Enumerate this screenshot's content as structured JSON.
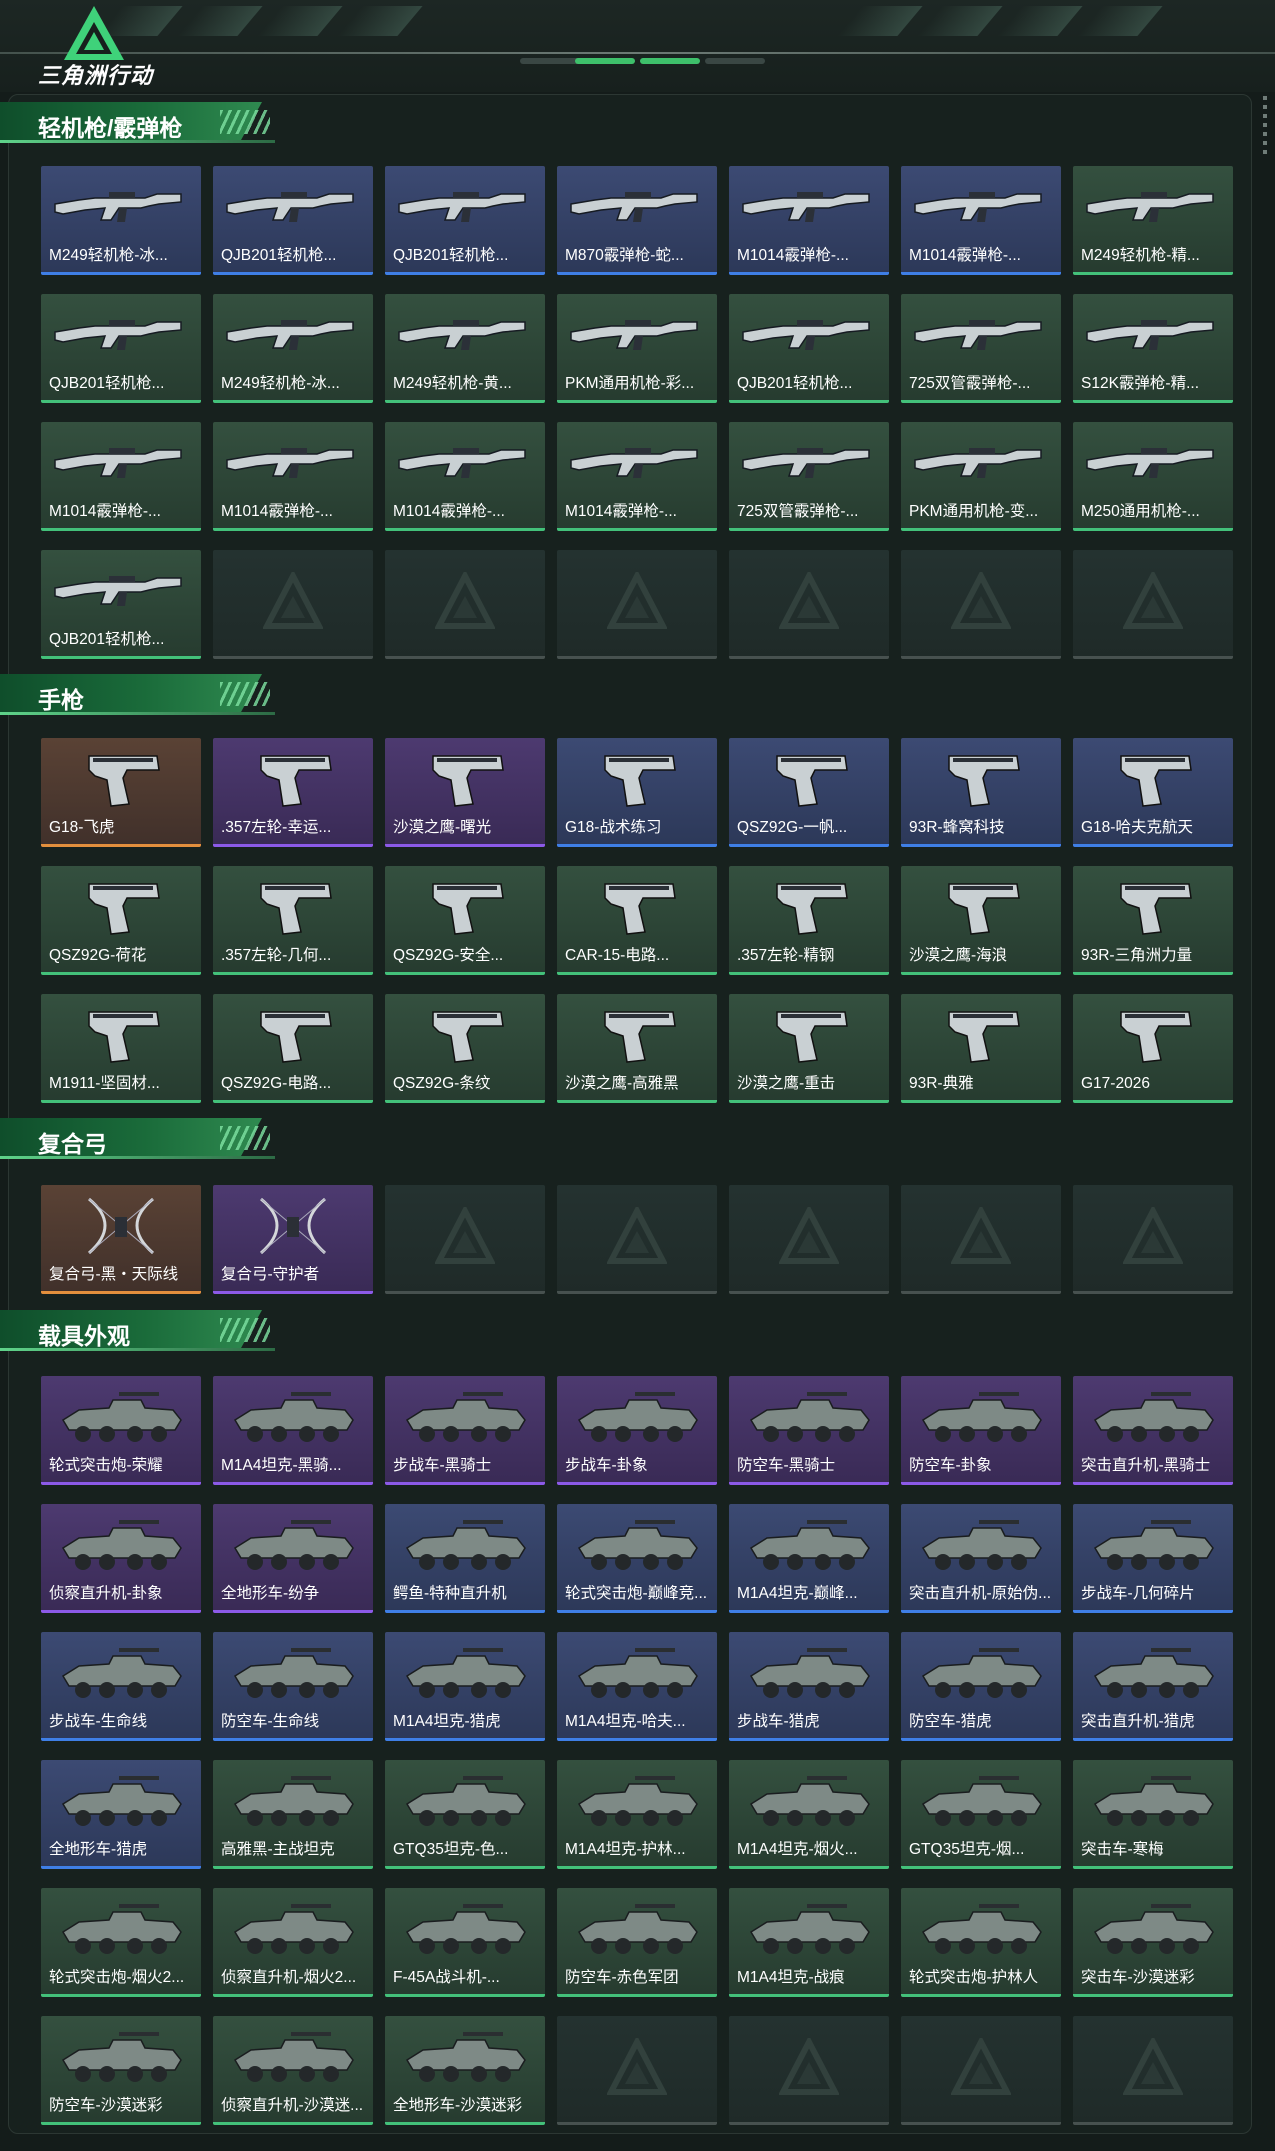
{
  "app": {
    "title": "三角洲行动"
  },
  "colors": {
    "accent": "#2f8a50",
    "blue": "#3f7fe6",
    "green": "#43c17a",
    "purple": "#8c5ae8",
    "orange": "#e38f3d"
  },
  "sections": [
    {
      "title": "轻机枪/霰弹枪",
      "icon": "gun",
      "items": [
        {
          "name": "M249轻机枪-冰...",
          "quality": "blue"
        },
        {
          "name": "QJB201轻机枪...",
          "quality": "blue"
        },
        {
          "name": "QJB201轻机枪...",
          "quality": "blue"
        },
        {
          "name": "M870霰弹枪-蛇...",
          "quality": "blue"
        },
        {
          "name": "M1014霰弹枪-...",
          "quality": "blue"
        },
        {
          "name": "M1014霰弹枪-...",
          "quality": "blue"
        },
        {
          "name": "M249轻机枪-精...",
          "quality": "green"
        },
        {
          "name": "QJB201轻机枪...",
          "quality": "green"
        },
        {
          "name": "M249轻机枪-冰...",
          "quality": "green"
        },
        {
          "name": "M249轻机枪-黄...",
          "quality": "green"
        },
        {
          "name": "PKM通用机枪-彩...",
          "quality": "green"
        },
        {
          "name": "QJB201轻机枪...",
          "quality": "green"
        },
        {
          "name": "725双管霰弹枪-...",
          "quality": "green"
        },
        {
          "name": "S12K霰弹枪-精...",
          "quality": "green"
        },
        {
          "name": "M1014霰弹枪-...",
          "quality": "green"
        },
        {
          "name": "M1014霰弹枪-...",
          "quality": "green"
        },
        {
          "name": "M1014霰弹枪-...",
          "quality": "green"
        },
        {
          "name": "M1014霰弹枪-...",
          "quality": "green"
        },
        {
          "name": "725双管霰弹枪-...",
          "quality": "green"
        },
        {
          "name": "PKM通用机枪-变...",
          "quality": "green"
        },
        {
          "name": "M250通用机枪-...",
          "quality": "green"
        },
        {
          "name": "QJB201轻机枪...",
          "quality": "green"
        }
      ],
      "slots": 28
    },
    {
      "title": "手枪",
      "icon": "pistol",
      "items": [
        {
          "name": "G18-飞虎",
          "quality": "orange"
        },
        {
          "name": ".357左轮-幸运...",
          "quality": "purple"
        },
        {
          "name": "沙漠之鹰-曙光",
          "quality": "purple"
        },
        {
          "name": "G18-战术练习",
          "quality": "blue"
        },
        {
          "name": "QSZ92G-一帆...",
          "quality": "blue"
        },
        {
          "name": "93R-蜂窝科技",
          "quality": "blue"
        },
        {
          "name": "G18-哈夫克航天",
          "quality": "blue"
        },
        {
          "name": "QSZ92G-荷花",
          "quality": "green"
        },
        {
          "name": ".357左轮-几何...",
          "quality": "green"
        },
        {
          "name": "QSZ92G-安全...",
          "quality": "green"
        },
        {
          "name": "CAR-15-电路...",
          "quality": "green"
        },
        {
          "name": ".357左轮-精钢",
          "quality": "green"
        },
        {
          "name": "沙漠之鹰-海浪",
          "quality": "green"
        },
        {
          "name": "93R-三角洲力量",
          "quality": "green"
        },
        {
          "name": "M1911-坚固材...",
          "quality": "green"
        },
        {
          "name": "QSZ92G-电路...",
          "quality": "green"
        },
        {
          "name": "QSZ92G-条纹",
          "quality": "green"
        },
        {
          "name": "沙漠之鹰-高雅黑",
          "quality": "green"
        },
        {
          "name": "沙漠之鹰-重击",
          "quality": "green"
        },
        {
          "name": "93R-典雅",
          "quality": "green"
        },
        {
          "name": "G17-2026",
          "quality": "green"
        }
      ],
      "slots": 21
    },
    {
      "title": "复合弓",
      "icon": "bow",
      "items": [
        {
          "name": "复合弓-黑・天际线",
          "quality": "orange"
        },
        {
          "name": "复合弓-守护者",
          "quality": "purple"
        }
      ],
      "slots": 7
    },
    {
      "title": "载具外观",
      "icon": "vehicle",
      "items": [
        {
          "name": "轮式突击炮-荣耀",
          "quality": "purple"
        },
        {
          "name": "M1A4坦克-黑骑...",
          "quality": "purple"
        },
        {
          "name": "步战车-黑骑士",
          "quality": "purple"
        },
        {
          "name": "步战车-卦象",
          "quality": "purple"
        },
        {
          "name": "防空车-黑骑士",
          "quality": "purple"
        },
        {
          "name": "防空车-卦象",
          "quality": "purple"
        },
        {
          "name": "突击直升机-黑骑士",
          "quality": "purple"
        },
        {
          "name": "侦察直升机-卦象",
          "quality": "purple"
        },
        {
          "name": "全地形车-纷争",
          "quality": "purple"
        },
        {
          "name": "鳄鱼-特种直升机",
          "quality": "blue"
        },
        {
          "name": "轮式突击炮-巅峰竞...",
          "quality": "blue"
        },
        {
          "name": "M1A4坦克-巅峰...",
          "quality": "blue"
        },
        {
          "name": "突击直升机-原始伪...",
          "quality": "blue"
        },
        {
          "name": "步战车-几何碎片",
          "quality": "blue"
        },
        {
          "name": "步战车-生命线",
          "quality": "blue"
        },
        {
          "name": "防空车-生命线",
          "quality": "blue"
        },
        {
          "name": "M1A4坦克-猎虎",
          "quality": "blue"
        },
        {
          "name": "M1A4坦克-哈夫...",
          "quality": "blue"
        },
        {
          "name": "步战车-猎虎",
          "quality": "blue"
        },
        {
          "name": "防空车-猎虎",
          "quality": "blue"
        },
        {
          "name": "突击直升机-猎虎",
          "quality": "blue"
        },
        {
          "name": "全地形车-猎虎",
          "quality": "blue"
        },
        {
          "name": "高雅黑-主战坦克",
          "quality": "green"
        },
        {
          "name": "GTQ35坦克-色...",
          "quality": "green"
        },
        {
          "name": "M1A4坦克-护林...",
          "quality": "green"
        },
        {
          "name": "M1A4坦克-烟火...",
          "quality": "green"
        },
        {
          "name": "GTQ35坦克-烟...",
          "quality": "green"
        },
        {
          "name": "突击车-寒梅",
          "quality": "green"
        },
        {
          "name": "轮式突击炮-烟火2...",
          "quality": "green"
        },
        {
          "name": "侦察直升机-烟火2...",
          "quality": "green"
        },
        {
          "name": "F-45A战斗机-...",
          "quality": "green"
        },
        {
          "name": "防空车-赤色军团",
          "quality": "green"
        },
        {
          "name": "M1A4坦克-战痕",
          "quality": "green"
        },
        {
          "name": "轮式突击炮-护林人",
          "quality": "green"
        },
        {
          "name": "突击车-沙漠迷彩",
          "quality": "green"
        },
        {
          "name": "防空车-沙漠迷彩",
          "quality": "green"
        },
        {
          "name": "侦察直升机-沙漠迷...",
          "quality": "green"
        },
        {
          "name": "全地形车-沙漠迷彩",
          "quality": "green"
        }
      ],
      "slots": 42
    }
  ]
}
